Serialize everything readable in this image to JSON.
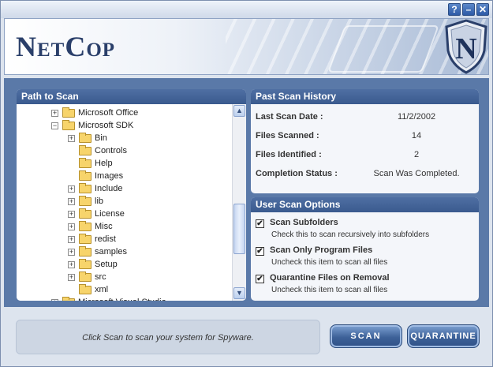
{
  "window": {
    "controls": {
      "help": "?",
      "minimize": "–",
      "close": "✕"
    }
  },
  "header": {
    "logo": "NetCop",
    "emblem_letter": "N"
  },
  "path_to_scan": {
    "title": "Path to Scan",
    "tree": [
      {
        "label": "Microsoft Office",
        "depth": 0,
        "expander": "+"
      },
      {
        "label": "Microsoft SDK",
        "depth": 0,
        "expander": "−"
      },
      {
        "label": "Bin",
        "depth": 1,
        "expander": "+"
      },
      {
        "label": "Controls",
        "depth": 1,
        "expander": ""
      },
      {
        "label": "Help",
        "depth": 1,
        "expander": ""
      },
      {
        "label": "Images",
        "depth": 1,
        "expander": ""
      },
      {
        "label": "Include",
        "depth": 1,
        "expander": "+"
      },
      {
        "label": "lib",
        "depth": 1,
        "expander": "+"
      },
      {
        "label": "License",
        "depth": 1,
        "expander": "+"
      },
      {
        "label": "Misc",
        "depth": 1,
        "expander": "+"
      },
      {
        "label": "redist",
        "depth": 1,
        "expander": "+"
      },
      {
        "label": "samples",
        "depth": 1,
        "expander": "+"
      },
      {
        "label": "Setup",
        "depth": 1,
        "expander": "+"
      },
      {
        "label": "src",
        "depth": 1,
        "expander": "+"
      },
      {
        "label": "xml",
        "depth": 1,
        "expander": ""
      },
      {
        "label": "Microsoft Visual Studio",
        "depth": 0,
        "expander": "+"
      }
    ],
    "scroll_up": "▲",
    "scroll_down": "▼"
  },
  "history": {
    "title": "Past Scan History",
    "rows": [
      {
        "label": "Last Scan Date :",
        "value": "11/2/2002"
      },
      {
        "label": "Files Scanned :",
        "value": "14"
      },
      {
        "label": "Files Identified :",
        "value": "2"
      },
      {
        "label": "Completion Status :",
        "value": "Scan Was Completed."
      }
    ]
  },
  "options": {
    "title": "User Scan Options",
    "items": [
      {
        "title": "Scan Subfolders",
        "desc": "Check this to scan recursively into subfolders",
        "checked": true,
        "mark": "✔"
      },
      {
        "title": "Scan Only Program Files",
        "desc": "Uncheck this item to scan all files",
        "checked": true,
        "mark": "✔"
      },
      {
        "title": "Quarantine Files on Removal",
        "desc": "Uncheck this item to scan all files",
        "checked": true,
        "mark": "✔"
      }
    ]
  },
  "footer": {
    "status": "Click Scan to scan your system for Spyware.",
    "scan_button": "SCAN",
    "quarantine_button": "QUARANTINE"
  },
  "colors": {
    "accent": "#3a5a8e",
    "folder": "#f7d46b"
  }
}
